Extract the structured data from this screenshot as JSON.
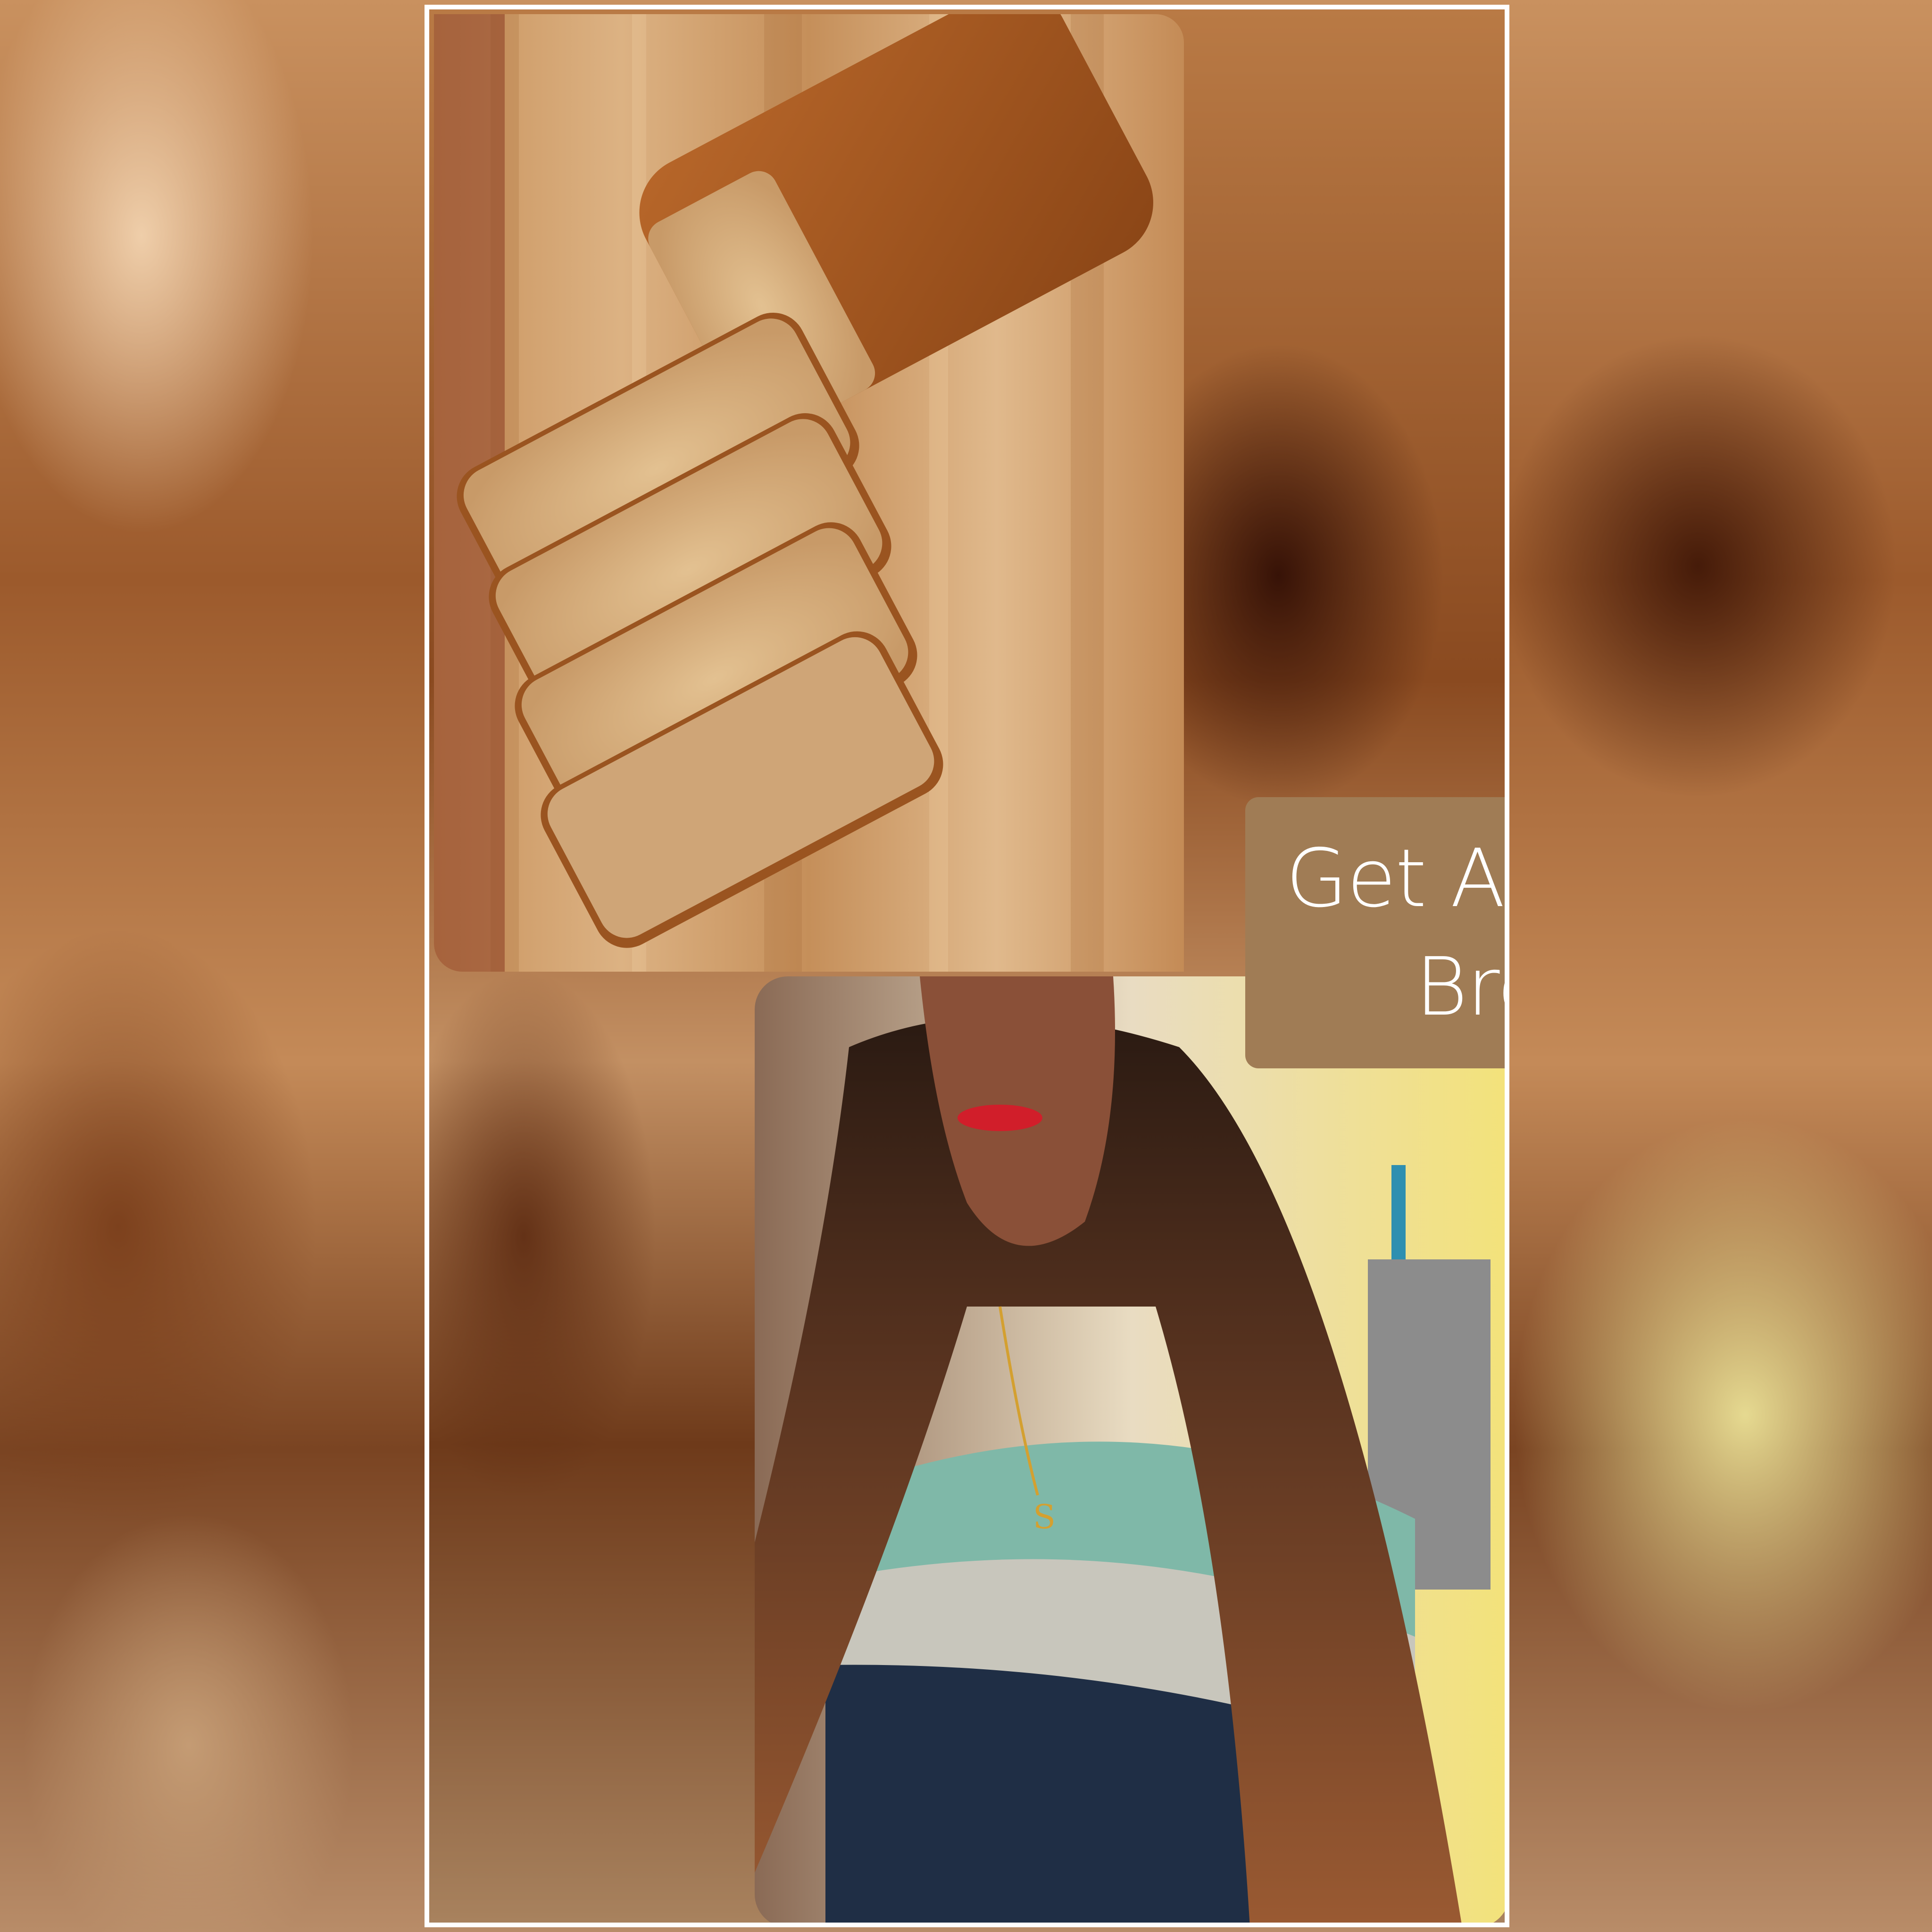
{
  "title_card": {
    "text": "Get A Brown Bread",
    "background_color": "#a07c55",
    "text_color": "#ffffff"
  },
  "photos": [
    {
      "subject": "sliced brown bread loaf on wooden cutting board"
    },
    {
      "subject": "woman with long wavy brown hair, red lipstick, gold S pendant necklace, striped top"
    }
  ],
  "colors": {
    "frame": "#ffffff",
    "background": "#9c5a2c"
  }
}
